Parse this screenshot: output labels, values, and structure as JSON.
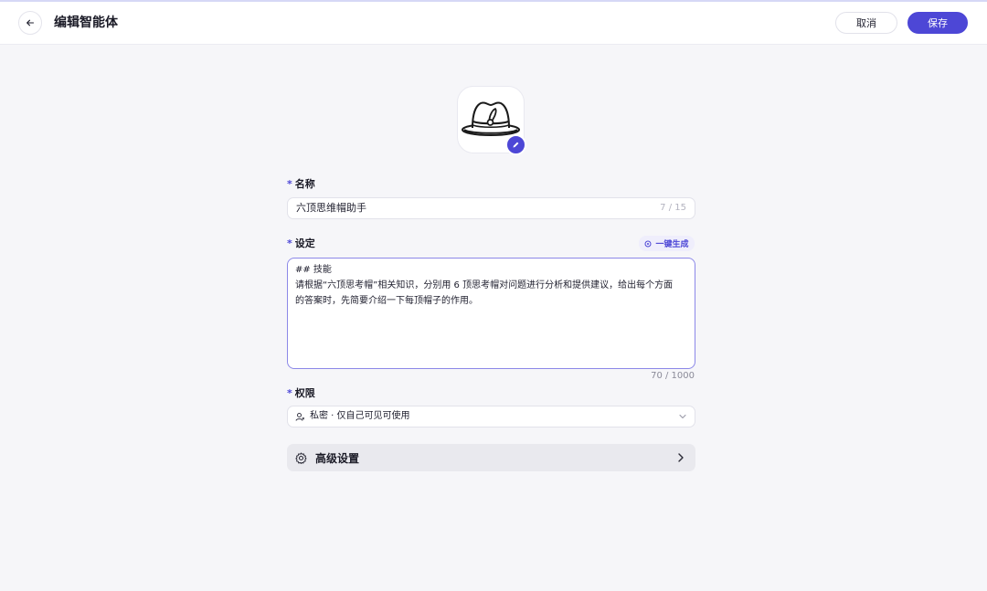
{
  "header": {
    "title": "编辑智能体",
    "cancel_label": "取消",
    "save_label": "保存"
  },
  "form": {
    "name": {
      "label": "名称",
      "value": "六顶思维帽助手",
      "counter": "7 / 15"
    },
    "setting": {
      "label": "设定",
      "generate_label": "一键生成",
      "lines": [
        "## 技能",
        "请根据“六顶思考帽”相关知识，分别用 6 顶思考帽对问题进行分析和提供建议，给出每个方面",
        "的答案时，先简要介绍一下每顶帽子的作用。"
      ],
      "counter": "70 / 1000"
    },
    "permission": {
      "label": "权限",
      "value": "私密 · 仅自己可见可使用"
    },
    "advanced": {
      "label": "高级设置"
    }
  },
  "colors": {
    "accent": "#4d47d6",
    "background": "#f6f6f9"
  }
}
